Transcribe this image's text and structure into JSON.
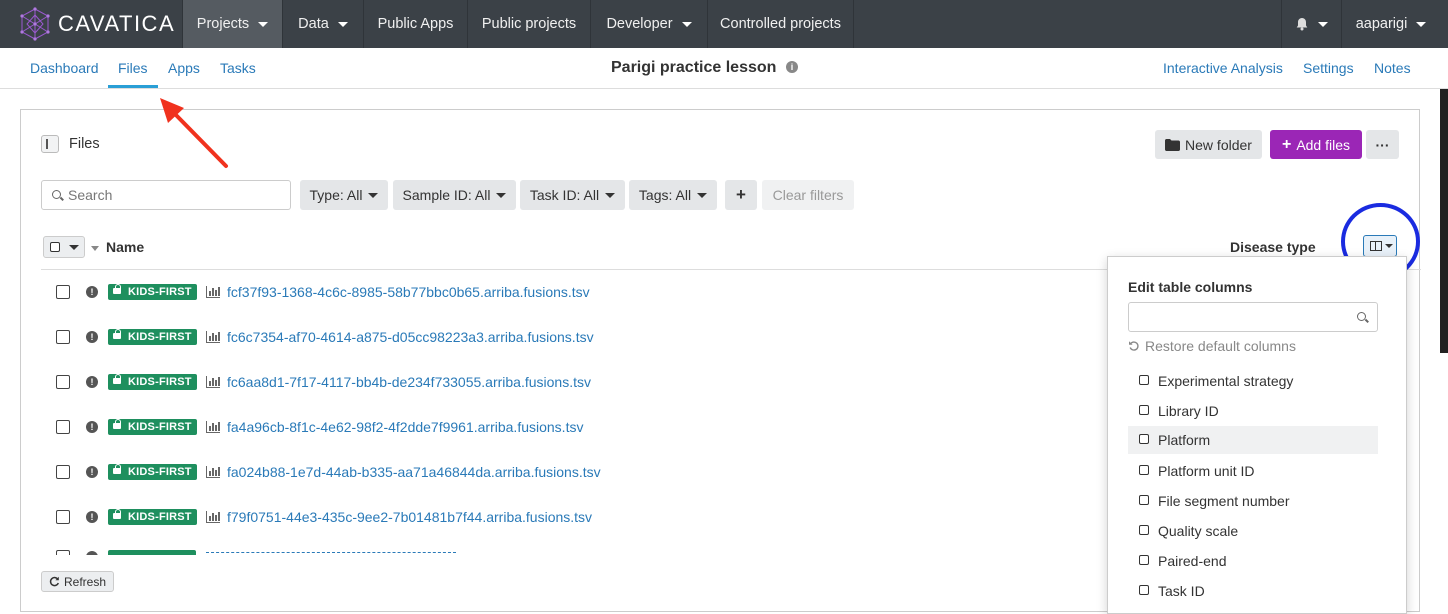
{
  "topnav": {
    "logo_text": "CAVATICA",
    "items": [
      {
        "label": "Projects",
        "dropdown": true,
        "active": true
      },
      {
        "label": "Data",
        "dropdown": true
      },
      {
        "label": "Public Apps"
      },
      {
        "label": "Public projects"
      },
      {
        "label": "Developer",
        "dropdown": true
      },
      {
        "label": "Controlled projects"
      }
    ],
    "user": "aaparigi",
    "icons": [
      "bell-icon"
    ]
  },
  "subnav": {
    "left": [
      "Dashboard",
      "Files",
      "Apps",
      "Tasks"
    ],
    "active": "Files",
    "title": "Parigi practice lesson",
    "right": [
      "Interactive Analysis",
      "Settings",
      "Notes"
    ]
  },
  "files_panel": {
    "heading": "Files",
    "new_folder": "New folder",
    "add_files": "Add files",
    "more": "···",
    "search_placeholder": "Search",
    "filters": [
      "Type: All",
      "Sample ID: All",
      "Task ID: All",
      "Tags: All"
    ],
    "add_filter": "+",
    "clear_filters": "Clear filters",
    "columns": {
      "name": "Name",
      "disease_type": "Disease type"
    },
    "rows": [
      {
        "tag": "KIDS-FIRST",
        "name": "fcf37f93-1368-4c6c-8985-58b77bbc0b65.arriba.fusions.tsv"
      },
      {
        "tag": "KIDS-FIRST",
        "name": "fc6c7354-af70-4614-a875-d05cc98223a3.arriba.fusions.tsv"
      },
      {
        "tag": "KIDS-FIRST",
        "name": "fc6aa8d1-7f17-4117-bb4b-de234f733055.arriba.fusions.tsv"
      },
      {
        "tag": "KIDS-FIRST",
        "name": "fa4a96cb-8f1c-4e62-98f2-4f2dde7f9961.arriba.fusions.tsv"
      },
      {
        "tag": "KIDS-FIRST",
        "name": "fa024b88-1e7d-44ab-b335-aa71a46844da.arriba.fusions.tsv"
      },
      {
        "tag": "KIDS-FIRST",
        "name": "f79f0751-44e3-435c-9ee2-7b01481b7f44.arriba.fusions.tsv"
      }
    ],
    "refresh": "Refresh"
  },
  "column_menu": {
    "title": "Edit table columns",
    "search_value": "",
    "restore": "Restore default columns",
    "items": [
      {
        "label": "Experimental strategy",
        "checked": false
      },
      {
        "label": "Library ID",
        "checked": false
      },
      {
        "label": "Platform",
        "checked": false,
        "hovered": true
      },
      {
        "label": "Platform unit ID",
        "checked": false
      },
      {
        "label": "File segment number",
        "checked": false
      },
      {
        "label": "Quality scale",
        "checked": false
      },
      {
        "label": "Paired-end",
        "checked": false
      },
      {
        "label": "Task ID",
        "checked": false
      }
    ]
  },
  "colors": {
    "topnav_bg": "#3b4147",
    "link": "#2a7ab8",
    "add_files": "#9b26b6",
    "badge": "#1e8f5e",
    "annotation_arrow": "#f0321e",
    "annotation_circle": "#1a2be0"
  }
}
